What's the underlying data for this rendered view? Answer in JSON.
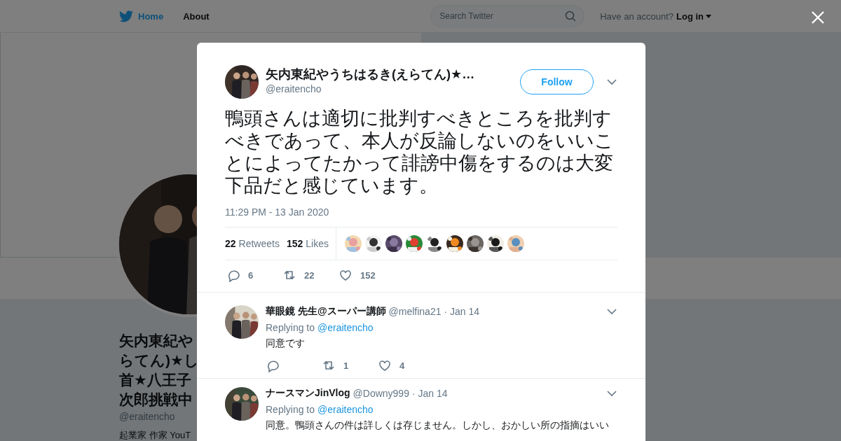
{
  "top_nav": {
    "links": [
      "Home",
      "About"
    ],
    "search": {
      "placeholder": "Search Twitter"
    },
    "account_prompt": "Have an account?",
    "login": "Log in"
  },
  "profile": {
    "name_lines": [
      "矢内東紀や",
      "らてん)★し",
      "首★八王子",
      "次郎挑戦中"
    ],
    "handle": "@eraitencho",
    "bio": "起業家 作家 YouT"
  },
  "tweet": {
    "author": "矢内東紀やうちはるき(えらてん)★…",
    "handle": "@eraitencho",
    "follow_label": "Follow",
    "text": "鴨頭さんは適切に批判すべきところを批判すべきであって、本人が反論しないのをいいことによってたかって誹謗中傷をするのは大変下品だと感じています。",
    "time": "11:29 PM - 13 Jan 2020",
    "retweets_count": "22",
    "retweets_label": "Retweets",
    "likes_count": "152",
    "likes_label": "Likes",
    "actions": [
      {
        "kind": "reply",
        "count": "6"
      },
      {
        "kind": "retweet",
        "count": "22"
      },
      {
        "kind": "like",
        "count": "152"
      }
    ]
  },
  "replies": [
    {
      "name": "華眼鏡 先生@スーパー講師",
      "handle": "@melfina21",
      "date": "· Jan 14",
      "replying_label": "Replying to",
      "replying_to": "@eraitencho",
      "text": "同意です",
      "actions": [
        {
          "kind": "reply"
        },
        {
          "kind": "retweet",
          "count": "1"
        },
        {
          "kind": "like",
          "count": "4"
        }
      ]
    },
    {
      "name": "ナースマンJinVlog",
      "handle": "@Downy999",
      "date": "· Jan 14",
      "replying_label": "Replying to",
      "replying_to": "@eraitencho",
      "text": "同意。鴨頭さんの件は詳しくは存じません。しかし、おかしい所の指摘はいい"
    }
  ]
}
